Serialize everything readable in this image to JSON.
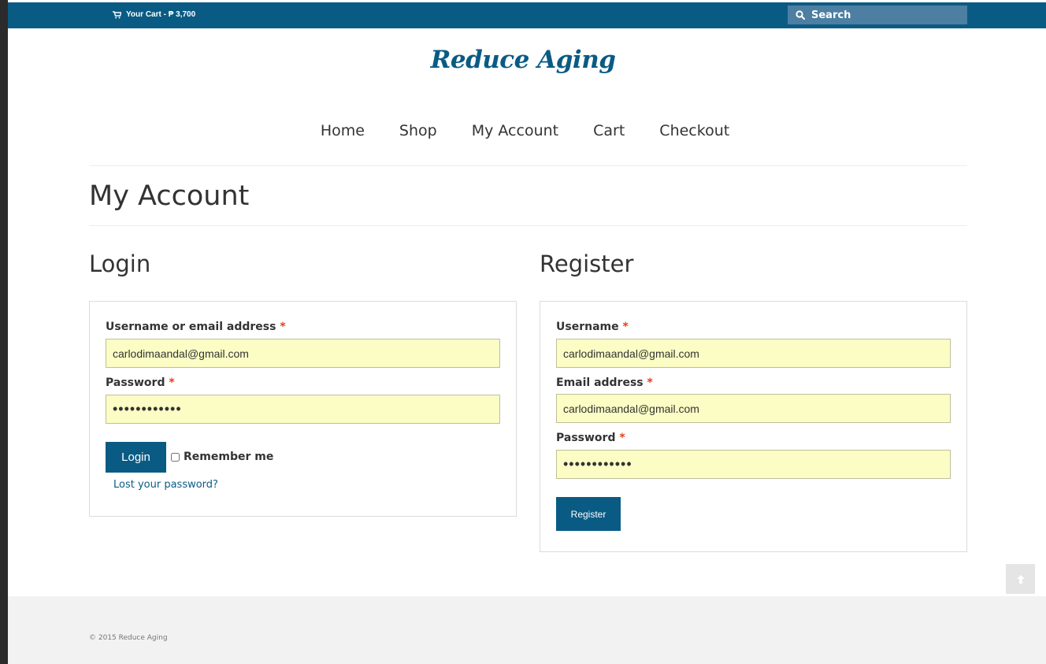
{
  "topbar": {
    "cart_label": "Your Cart - ₱ 3,700",
    "search_placeholder": "Search"
  },
  "site": {
    "logo": "Reduce Aging"
  },
  "nav": {
    "items": [
      "Home",
      "Shop",
      "My Account",
      "Cart",
      "Checkout"
    ]
  },
  "page": {
    "title": "My Account"
  },
  "login": {
    "title": "Login",
    "username_label": "Username or email address",
    "username_value": "carlodimaandal@gmail.com",
    "password_label": "Password",
    "password_value": "••••••••••••",
    "login_button": "Login",
    "remember_label": "Remember me",
    "lost_password": "Lost your password?"
  },
  "register": {
    "title": "Register",
    "username_label": "Username",
    "username_value": "carlodimaandal@gmail.com",
    "email_label": "Email address",
    "email_value": "carlodimaandal@gmail.com",
    "password_label": "Password",
    "password_value": "••••••••••••",
    "register_button": "Register"
  },
  "required_marker": "*",
  "footer": {
    "copyright": "© 2015 Reduce Aging"
  },
  "colors": {
    "brand": "#0a5b84",
    "input_bg": "#fbfdc4",
    "required": "#e2401c"
  }
}
